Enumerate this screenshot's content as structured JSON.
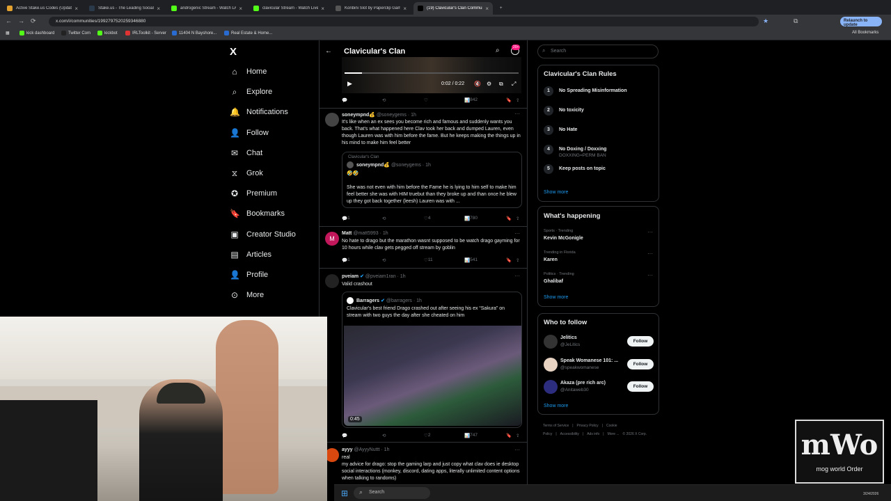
{
  "browser": {
    "tabs": [
      {
        "label": "Active Stake.us Codes (Updated",
        "color": "#e3a12f"
      },
      {
        "label": "Stake.us - The Leading Social C",
        "color": "#2b3a4a"
      },
      {
        "label": "androgenic Stream - Watch Live",
        "color": "#53fc18"
      },
      {
        "label": "clavicular Stream - Watch Live",
        "color": "#53fc18"
      },
      {
        "label": "Konbini Slot by Paperclip Gami",
        "color": "#555555"
      },
      {
        "label": "(19) Clavicular's Clan Commun",
        "color": "#000000"
      }
    ],
    "url": "x.com/i/communities/1992797520259346880",
    "relaunch": "Relaunch to update",
    "bookmarks": [
      "kick dashboard",
      "Twitter Com",
      "kickbot",
      "IRLToolkit - Server",
      "11404 N Bayshore...",
      "Real Estate & Home..."
    ],
    "all_bookmarks": "All Bookmarks"
  },
  "nav": {
    "items": [
      "Home",
      "Explore",
      "Notifications",
      "Follow",
      "Chat",
      "Grok",
      "Premium",
      "Bookmarks",
      "Creator Studio",
      "Articles",
      "Profile",
      "More"
    ],
    "notif_badge": "",
    "logo": "X"
  },
  "header": {
    "title": "Clavicular's Clan",
    "badge": "20+"
  },
  "video": {
    "time": "0:02 / 0:22",
    "replies": "",
    "likes": "",
    "views": "842"
  },
  "posts": [
    {
      "name": "soneympnd💰",
      "handle": "@soneygems · 1h",
      "text": "It's like when an ex sees you become rich and famous and suddenly wants you back. That's what happened here Clav took her back and dumped Lauren, even though Lauren was with him before the fame. But he keeps making the things up in his mind to make him feel better",
      "quote_community": "Clavicular's Clan",
      "quote_name": "soneympnd💰",
      "quote_handle": "@soneygems · 1h",
      "quote_emoji": "🤣🤣",
      "quote_text": "She was not even with him before the Fame he is lying to him self to make him feel better she was with HIM truebut  than they broke up and than once he blew up they got back together (leesh) Lauren was with ...",
      "replies": "1",
      "likes": "4",
      "views": "780"
    },
    {
      "name": "Matt",
      "handle": "@matt5993 · 1h",
      "text": "No hate to drago but the marathon wasnt supposed to be watch drago gayming for 10 hours while clav gets pegged off stream by goblin",
      "replies": "1",
      "likes": "11",
      "views": "541",
      "avatar_letter": "M"
    },
    {
      "name": "pveiam",
      "handle": "@pveiam1ran · 1h",
      "text": "Valid crashout",
      "quote_name": "Barragers",
      "quote_handle": "@barragers · 1h",
      "quote_text": "Clavicular's best friend Drago crashed out after seeing his ex “Sakura” on stream with two guys the day after she cheated on him",
      "video_time": "0:45",
      "replies": "",
      "likes": "2",
      "views": "747"
    },
    {
      "name": "ayyy",
      "handle": "@AyyyNuttt · 1h",
      "text": "real\nmy advice for drago: stop the gaming larp and just copy what clav does ie desktop social interactions (monkey, discord, dating apps, literally unlimited content options when talking to randoms)"
    }
  ],
  "right": {
    "search_placeholder": "Search",
    "rules_title": "Clavicular's Clan Rules",
    "rules": [
      {
        "n": "1",
        "text": "No Spreading Misinformation",
        "sub": ""
      },
      {
        "n": "2",
        "text": "No toxicity",
        "sub": ""
      },
      {
        "n": "3",
        "text": "No Hate",
        "sub": ""
      },
      {
        "n": "4",
        "text": "No Doxing / Doxxing",
        "sub": "DOXXING=PERM BAN"
      },
      {
        "n": "5",
        "text": "Keep posts on topic",
        "sub": ""
      }
    ],
    "show_more": "Show more",
    "happening_title": "What's happening",
    "trends": [
      {
        "cat": "Sports · Trending",
        "name": "Kevin McGonigle"
      },
      {
        "cat": "Trending in Florida",
        "name": "Karen"
      },
      {
        "cat": "Politics · Trending",
        "name": "Ghalibaf"
      }
    ],
    "follow_title": "Who to follow",
    "follow": [
      {
        "name": "Jelitics",
        "handle": "@JeLitics"
      },
      {
        "name": "Speak Womanese 101: ...",
        "handle": "@speakwomanese"
      },
      {
        "name": "Akaza (pre rich arc)",
        "handle": "@Anitaweb30"
      }
    ],
    "follow_btn": "Follow",
    "footer": [
      "Terms of Service",
      "|",
      "Privacy Policy",
      "|",
      "Cookie Policy",
      "|",
      "Accessibility",
      "|",
      "Ads info",
      "|",
      "More ...",
      "© 2026 X Corp."
    ]
  },
  "overlay": {
    "logo_text": "mWo",
    "logo_sub": "mog world Order"
  },
  "taskbar": {
    "search": "Search",
    "time": "",
    "date": "3/24/2026"
  }
}
